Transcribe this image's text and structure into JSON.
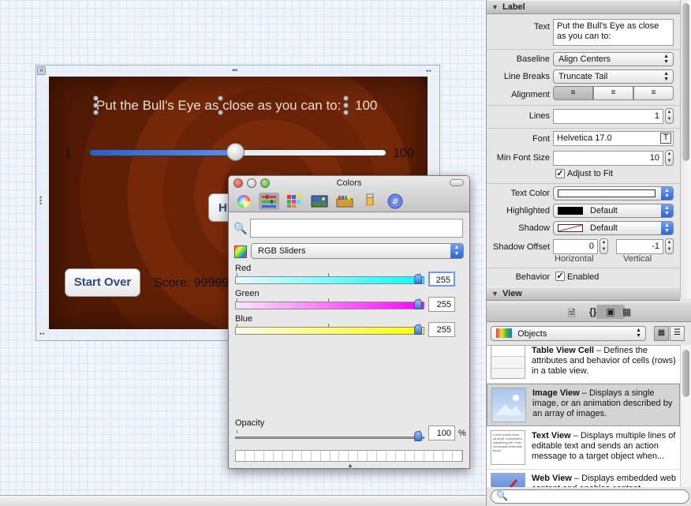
{
  "canvas": {
    "prompt": "Put the Bull's Eye as close as you can to:",
    "target_value": "100",
    "slider_min": "1",
    "slider_max": "100",
    "slider_fraction": 0.49,
    "hit_button_label": "Hit Me!",
    "start_over_label": "Start Over",
    "score_label": "Score: 99999"
  },
  "colors_panel": {
    "title": "Colors",
    "mode_select": "RGB Sliders",
    "search_placeholder": "",
    "channels": [
      {
        "label": "Red",
        "value": "255",
        "gradient": [
          "#e6fbfb",
          "#00ffff"
        ]
      },
      {
        "label": "Green",
        "value": "255",
        "gradient": [
          "#fbe6fb",
          "#ff00ff"
        ]
      },
      {
        "label": "Blue",
        "value": "255",
        "gradient": [
          "#fbfbe6",
          "#ffff00"
        ]
      }
    ],
    "opacity_label": "Opacity",
    "opacity_value": "100",
    "opacity_unit": "%",
    "mode_icons": [
      "color-wheel-icon",
      "color-sliders-icon",
      "color-palettes-icon",
      "image-palettes-icon",
      "crayons-icon",
      "pencil-icon",
      "hex-icon"
    ]
  },
  "inspector": {
    "label_section": "Label",
    "text_label": "Text",
    "text_value_line1": "Put the Bull's Eye as close",
    "text_value_line2": "as you can to:",
    "baseline_label": "Baseline",
    "baseline_value": "Align Centers",
    "line_breaks_label": "Line Breaks",
    "line_breaks_value": "Truncate Tail",
    "alignment_label": "Alignment",
    "lines_label": "Lines",
    "lines_value": "1",
    "font_label": "Font",
    "font_value": "Helvetica 17.0",
    "min_font_size_label": "Min Font Size",
    "min_font_size_value": "10",
    "adjust_to_fit_label": "Adjust to Fit",
    "text_color_label": "Text Color",
    "highlighted_label": "Highlighted",
    "highlighted_value": "Default",
    "shadow_label": "Shadow",
    "shadow_value": "Default",
    "shadow_offset_label": "Shadow Offset",
    "shadow_offset_h": "0",
    "shadow_offset_v": "-1",
    "horizontal_label": "Horizontal",
    "vertical_label": "Vertical",
    "behavior_label": "Behavior",
    "enabled_label": "Enabled",
    "view_section": "View"
  },
  "library": {
    "filter_value": "Objects",
    "items": [
      {
        "name": "Table View Cell",
        "desc": " – Defines the attributes and behavior of cells (rows) in a table view."
      },
      {
        "name": "Image View",
        "desc": " – Displays a single image, or an animation described by an array of images."
      },
      {
        "name": "Text View",
        "desc": " – Displays multiple lines of editable text and sends an action message to a target object when..."
      },
      {
        "name": "Web View",
        "desc": " – Displays embedded web content and enables content"
      }
    ]
  },
  "colors": {
    "accent": "#2c66d6",
    "game_background": "#5e1f05",
    "button_text": "#2c4a82"
  }
}
